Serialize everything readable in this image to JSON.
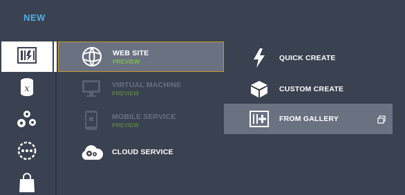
{
  "header": {
    "title": "NEW"
  },
  "rail": {
    "items": [
      {
        "name": "compute-icon",
        "selected": true
      },
      {
        "name": "data-services-icon",
        "selected": false
      },
      {
        "name": "app-services-icon",
        "selected": false
      },
      {
        "name": "network-services-icon",
        "selected": false
      },
      {
        "name": "store-icon",
        "selected": false
      }
    ]
  },
  "menu": {
    "items": [
      {
        "label": "WEB SITE",
        "sub": "PREVIEW",
        "icon": "globe-icon",
        "enabled": true,
        "selected": true
      },
      {
        "label": "VIRTUAL MACHINE",
        "sub": "PREVIEW",
        "icon": "monitor-icon",
        "enabled": false,
        "selected": false
      },
      {
        "label": "MOBILE SERVICE",
        "sub": "PREVIEW",
        "icon": "phone-icon",
        "enabled": false,
        "selected": false
      },
      {
        "label": "CLOUD SERVICE",
        "sub": "",
        "icon": "cloud-gear-icon",
        "enabled": true,
        "selected": false
      }
    ]
  },
  "panel": {
    "items": [
      {
        "label": "QUICK CREATE",
        "icon": "lightning-icon",
        "selected": false
      },
      {
        "label": "CUSTOM CREATE",
        "icon": "box-icon",
        "selected": false
      },
      {
        "label": "FROM GALLERY",
        "icon": "gallery-plus-icon",
        "selected": true
      }
    ]
  },
  "colors": {
    "background": "#3a4150",
    "accent_header": "#4fb0e8",
    "preview_green": "#7bbf45",
    "selected_bg": "#6a7181",
    "selected_border": "#c69b2e"
  }
}
